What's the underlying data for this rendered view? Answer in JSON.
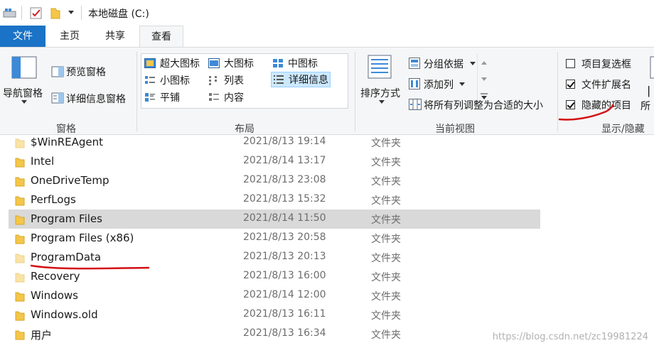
{
  "window": {
    "title": "本地磁盘 (C:)"
  },
  "tabs": [
    {
      "label": "文件"
    },
    {
      "label": "主页"
    },
    {
      "label": "共享"
    },
    {
      "label": "查看"
    }
  ],
  "ribbon": {
    "panes": {
      "nav_pane": "导航窗格",
      "preview_pane": "预览窗格",
      "details_pane": "详细信息窗格",
      "group_label": "窗格"
    },
    "layout": {
      "items": [
        "超大图标",
        "大图标",
        "中图标",
        "小图标",
        "列表",
        "详细信息",
        "平铺",
        "内容"
      ],
      "selected": "详细信息",
      "group_label": "布局"
    },
    "current_view": {
      "sort": "排序方式",
      "group_by": "分组依据",
      "add_column": "添加列",
      "size_all_columns": "将所有列调整为合适的大小",
      "group_label": "当前视图"
    },
    "show_hide": {
      "item_checkboxes": {
        "label": "项目复选框",
        "checked": false
      },
      "file_extensions": {
        "label": "文件扩展名",
        "checked": true
      },
      "hidden_items": {
        "label": "隐藏的项目",
        "checked": true
      },
      "group_label": "显示/隐藏",
      "cut_label": "所"
    }
  },
  "files": [
    {
      "name": "$WinREAgent",
      "date": "2021/8/13 19:14",
      "type": "文件夹"
    },
    {
      "name": "Intel",
      "date": "2021/8/14 13:17",
      "type": "文件夹"
    },
    {
      "name": "OneDriveTemp",
      "date": "2021/8/13 23:08",
      "type": "文件夹"
    },
    {
      "name": "PerfLogs",
      "date": "2021/8/13 15:32",
      "type": "文件夹"
    },
    {
      "name": "Program Files",
      "date": "2021/8/14 11:50",
      "type": "文件夹"
    },
    {
      "name": "Program Files (x86)",
      "date": "2021/8/13 20:58",
      "type": "文件夹"
    },
    {
      "name": "ProgramData",
      "date": "2021/8/13 20:13",
      "type": "文件夹"
    },
    {
      "name": "Recovery",
      "date": "2021/8/13 16:00",
      "type": "文件夹"
    },
    {
      "name": "Windows",
      "date": "2021/8/14 12:00",
      "type": "文件夹"
    },
    {
      "name": "Windows.old",
      "date": "2021/8/13 16:11",
      "type": "文件夹"
    },
    {
      "name": "用户",
      "date": "2021/8/13 16:34",
      "type": "文件夹"
    }
  ],
  "selected_file": "Program Files",
  "watermark": "https://blog.csdn.net/zc19981224",
  "colors": {
    "accent": "#1a73c6",
    "annotation": "#d40f12",
    "folder": "#f4c64a"
  }
}
